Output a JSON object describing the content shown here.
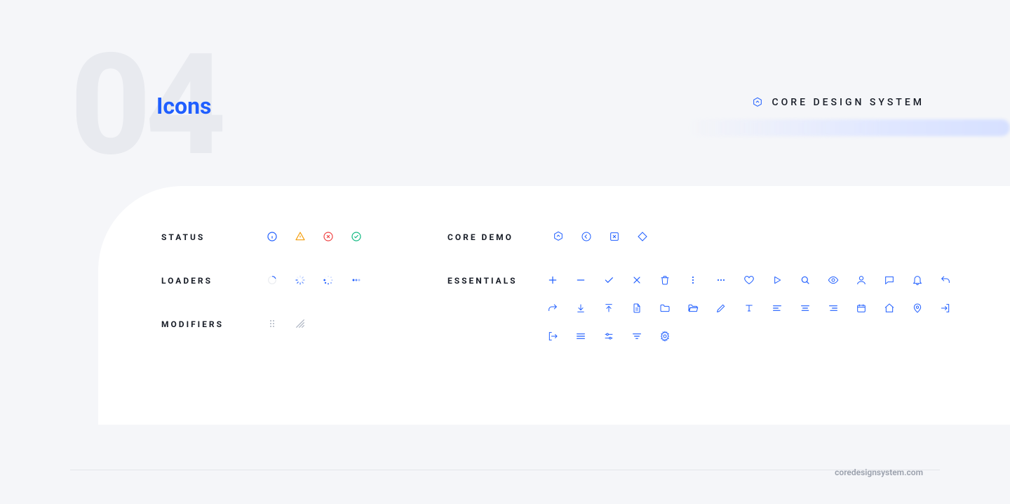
{
  "page": {
    "number": "04",
    "title": "Icons"
  },
  "brand": {
    "name": "CORE DESIGN SYSTEM"
  },
  "colors": {
    "primary": "#1f5eff",
    "info": "#1f5eff",
    "warning": "#f59e0b",
    "error": "#ef4444",
    "success": "#10b981",
    "muted": "#adb4c2"
  },
  "sections": {
    "status": {
      "label": "STATUS"
    },
    "loaders": {
      "label": "LOADERS"
    },
    "modifiers": {
      "label": "MODIFIERS"
    },
    "coredemo": {
      "label": "CORE DEMO"
    },
    "essentials": {
      "label": "ESSENTIALS"
    }
  },
  "icons": {
    "status": [
      "info",
      "warning",
      "error",
      "success"
    ],
    "loaders": [
      "spinner-ring",
      "spinner-ticks",
      "spinner-dots-ring",
      "dots-horizontal"
    ],
    "modifiers": [
      "drag-handle",
      "resize-handle"
    ],
    "coredemo": [
      "hexagon-up",
      "circle-left",
      "square-x",
      "diamond"
    ],
    "essentials": [
      "plus",
      "minus",
      "check",
      "x",
      "trash",
      "more-vertical",
      "more-horizontal",
      "heart",
      "play",
      "search",
      "eye",
      "user",
      "chat",
      "bell",
      "reply",
      "share",
      "download",
      "upload",
      "file",
      "folder",
      "folder-open",
      "edit",
      "text",
      "align-left",
      "align-center",
      "align-right",
      "calendar",
      "home",
      "location",
      "login",
      "logout",
      "menu",
      "sliders",
      "filter",
      "settings"
    ]
  },
  "footer": {
    "site": "coredesignsystem.com"
  }
}
